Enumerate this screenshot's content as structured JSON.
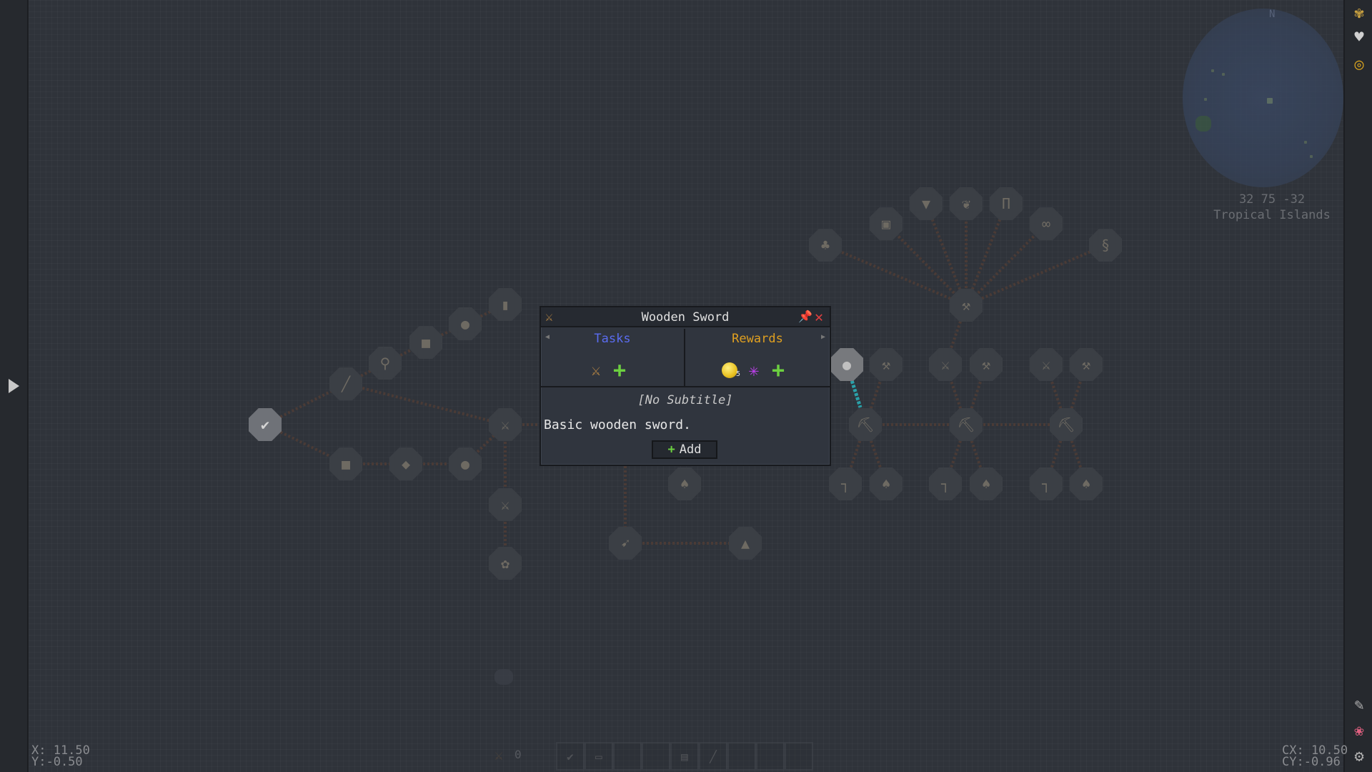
{
  "quest_panel": {
    "title": "Wooden Sword",
    "tasks_label": "Tasks",
    "rewards_label": "Rewards",
    "subtitle": "[No Subtitle]",
    "description": "Basic wooden sword.",
    "add_label": "Add",
    "coin_reward_count": "5",
    "colors": {
      "tasks": "#5a6cf0",
      "rewards": "#e0a020",
      "close": "#e04040",
      "add": "#6cd040"
    }
  },
  "minimap": {
    "compass": "N",
    "coords": "32 75 -32",
    "biome": "Tropical Islands"
  },
  "cursor_coords": {
    "x": "X: 11.50",
    "y": "Y:-0.50"
  },
  "center_coords": {
    "cx": "CX: 10.50",
    "cy": "CY:-0.96"
  },
  "hotbar": {
    "held_count": "0"
  },
  "icons": {
    "right_bar": [
      "quest-book-icon",
      "heart-icon",
      "coin-stack-icon",
      "pin-icon",
      "lotus-icon",
      "gear-icon"
    ],
    "left_bar": [
      "expand-arrow-icon"
    ]
  }
}
